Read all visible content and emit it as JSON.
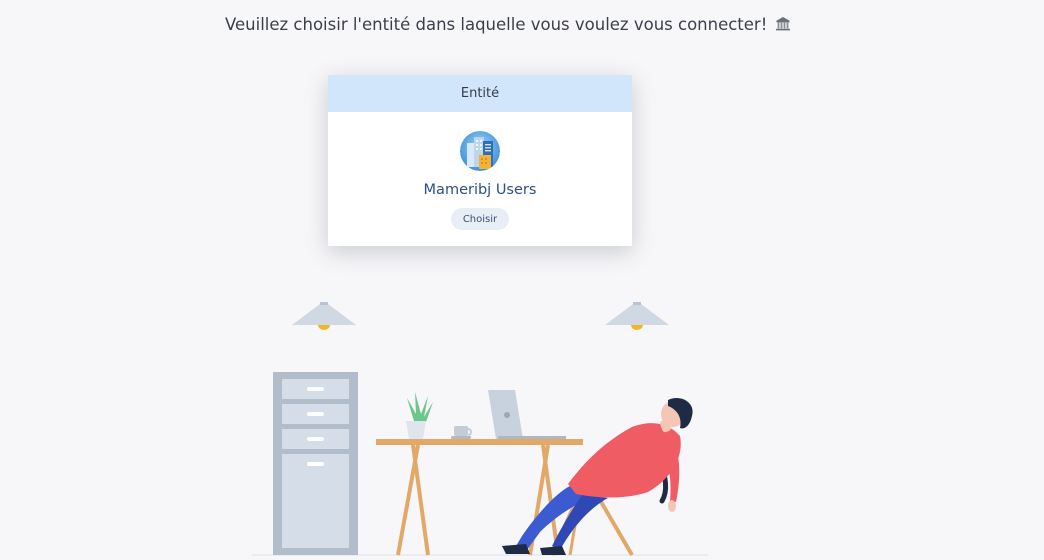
{
  "header": {
    "message": "Veuillez choisir l'entité dans laquelle vous voulez vous connecter!",
    "icon": "bank-icon"
  },
  "card": {
    "title": "Entité",
    "entity": {
      "name": "Mameribj Users",
      "avatar_icon": "buildings-icon"
    },
    "choose_label": "Choisir"
  },
  "colors": {
    "card_header_bg": "#d2e6fb",
    "entity_name": "#2b4f86",
    "button_bg": "#e8eef6",
    "page_bg": "#f7f7f9"
  }
}
